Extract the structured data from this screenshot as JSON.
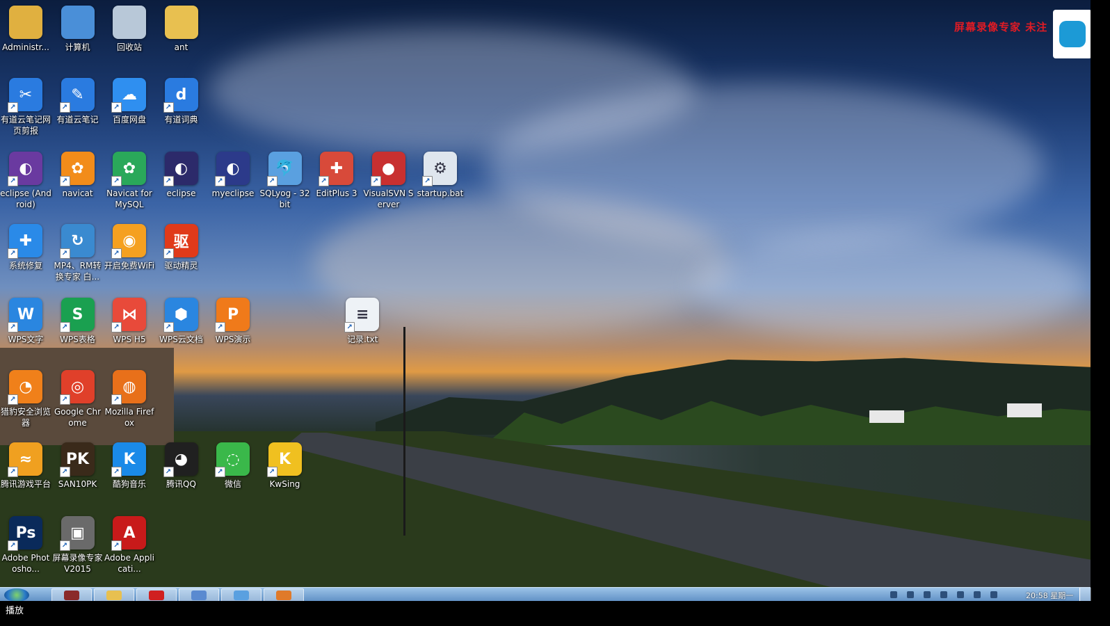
{
  "desktop": {
    "icons": [
      {
        "label": "Administr...",
        "icon": "user-folder-icon",
        "color": "#e0b040",
        "glyph": "",
        "x": 0,
        "y": 0
      },
      {
        "label": "计算机",
        "icon": "computer-icon",
        "color": "#4a8fd8",
        "glyph": "",
        "x": 0,
        "y": 0
      },
      {
        "label": "回收站",
        "icon": "recycle-bin-icon",
        "color": "#b8c8d8",
        "glyph": "",
        "x": 0,
        "y": 0
      },
      {
        "label": "ant",
        "icon": "folder-icon",
        "color": "#e8c050",
        "glyph": "",
        "x": 0,
        "y": 0
      },
      {
        "label": "有道云笔记网页剪报",
        "icon": "youdao-clipper-icon",
        "color": "#2a7be0",
        "glyph": "✂"
      },
      {
        "label": "有道云笔记",
        "icon": "youdao-note-icon",
        "color": "#2a7be0",
        "glyph": "✎"
      },
      {
        "label": "百度网盘",
        "icon": "baidu-netdisk-icon",
        "color": "#2f8ff0",
        "glyph": "☁"
      },
      {
        "label": "有道词典",
        "icon": "youdao-dict-icon",
        "color": "#2a7be0",
        "glyph": "d"
      },
      {
        "label": "eclipse (Android)",
        "icon": "eclipse-android-icon",
        "color": "#6a3aa0",
        "glyph": "◐"
      },
      {
        "label": "navicat",
        "icon": "navicat-icon",
        "color": "#f28c1a",
        "glyph": "✿"
      },
      {
        "label": "Navicat for MySQL",
        "icon": "navicat-mysql-icon",
        "color": "#2aa85a",
        "glyph": "✿"
      },
      {
        "label": "eclipse",
        "icon": "eclipse-icon",
        "color": "#2c2a6a",
        "glyph": "◐"
      },
      {
        "label": "myeclipse",
        "icon": "myeclipse-icon",
        "color": "#2c3a8a",
        "glyph": "◐"
      },
      {
        "label": "SQLyog - 32 bit",
        "icon": "sqlyog-icon",
        "color": "#5aa0e0",
        "glyph": "🐬"
      },
      {
        "label": "EditPlus 3",
        "icon": "editplus-icon",
        "color": "#d84a3a",
        "glyph": "✚"
      },
      {
        "label": "VisualSVN Server",
        "icon": "visualsvn-icon",
        "color": "#c83030",
        "glyph": "●"
      },
      {
        "label": "startup.bat",
        "icon": "gear-file-icon",
        "color": "#dfe6ee",
        "glyph": "⚙"
      },
      {
        "label": "系统修复",
        "icon": "system-repair-icon",
        "color": "#2a8ae8",
        "glyph": "✚"
      },
      {
        "label": "MP4、RM转换专家 白...",
        "icon": "mp4-converter-icon",
        "color": "#3a8ad0",
        "glyph": "↻"
      },
      {
        "label": "开启免费WiFi",
        "icon": "wifi-icon",
        "color": "#f5a020",
        "glyph": "◉"
      },
      {
        "label": "驱动精灵",
        "icon": "driver-genius-icon",
        "color": "#e03a1a",
        "glyph": "驱"
      },
      {
        "label": "WPS文字",
        "icon": "wps-writer-icon",
        "color": "#2a86e0",
        "glyph": "W"
      },
      {
        "label": "WPS表格",
        "icon": "wps-spreadsheet-icon",
        "color": "#1aa050",
        "glyph": "S"
      },
      {
        "label": "WPS H5",
        "icon": "wps-h5-icon",
        "color": "#e84a3a",
        "glyph": "⋈"
      },
      {
        "label": "WPS云文档",
        "icon": "wps-cloud-icon",
        "color": "#2a86e0",
        "glyph": "⬢"
      },
      {
        "label": "WPS演示",
        "icon": "wps-presentation-icon",
        "color": "#f07a1a",
        "glyph": "P"
      },
      {
        "label": "记录.txt",
        "icon": "text-file-icon",
        "color": "#eef2f6",
        "glyph": "≡"
      },
      {
        "label": "猎豹安全浏览器",
        "icon": "liebao-browser-icon",
        "color": "#f0801a",
        "glyph": "◔"
      },
      {
        "label": "Google Chrome",
        "icon": "chrome-icon",
        "color": "#e0402a",
        "glyph": "◎"
      },
      {
        "label": "Mozilla Firefox",
        "icon": "firefox-icon",
        "color": "#e8701a",
        "glyph": "◍"
      },
      {
        "label": "腾讯游戏平台",
        "icon": "tencent-game-icon",
        "color": "#f0a020",
        "glyph": "≈"
      },
      {
        "label": "SAN10PK",
        "icon": "san10pk-icon",
        "color": "#3a2a1a",
        "glyph": "PK"
      },
      {
        "label": "酷狗音乐",
        "icon": "kugou-icon",
        "color": "#1a8ae8",
        "glyph": "K"
      },
      {
        "label": "腾讯QQ",
        "icon": "qq-penguin-icon",
        "color": "#202020",
        "glyph": "◕"
      },
      {
        "label": "微信",
        "icon": "wechat-icon",
        "color": "#3ab84a",
        "glyph": "◌"
      },
      {
        "label": "KwSing",
        "icon": "kwsing-icon",
        "color": "#f0c020",
        "glyph": "K"
      },
      {
        "label": "Adobe Photosho...",
        "icon": "photoshop-icon",
        "color": "#0a2a5a",
        "glyph": "Ps"
      },
      {
        "label": "屏幕录像专家 V2015",
        "icon": "screen-recorder-icon",
        "color": "#6a6a6a",
        "glyph": "▣"
      },
      {
        "label": "Adobe Applicati...",
        "icon": "adobe-app-icon",
        "color": "#c81a1a",
        "glyph": "A"
      }
    ]
  },
  "watermark": {
    "text": "屏幕录像专家  未注",
    "color": "#e01b24"
  },
  "taskbar": {
    "clock": "20:58 星期一",
    "pinned": [
      {
        "name": "javaee-app-icon",
        "color": "#8a2a2a"
      },
      {
        "name": "explorer-folder-icon",
        "color": "#e8c050"
      },
      {
        "name": "red-app-icon",
        "color": "#d02020"
      },
      {
        "name": "image-app-icon",
        "color": "#5a8ad0"
      },
      {
        "name": "sqlyog-task-icon",
        "color": "#5aa0e0"
      },
      {
        "name": "browser-task-icon",
        "color": "#e07a2a"
      }
    ]
  },
  "statusbar": {
    "text": "播放"
  }
}
